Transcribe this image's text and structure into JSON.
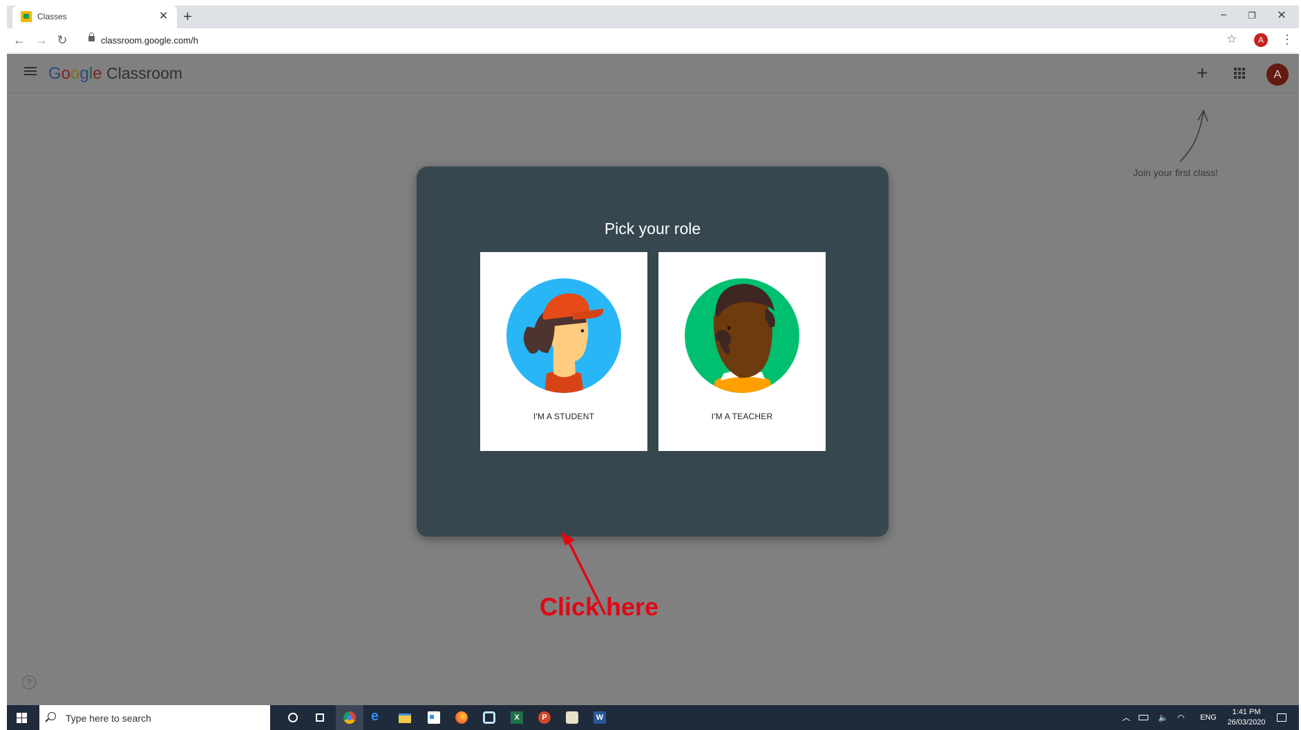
{
  "browser": {
    "tab_title": "Classes",
    "tab_close": "✕",
    "new_tab": "+",
    "url": "classroom.google.com/h",
    "profile_initial": "A",
    "window_minimize": "−",
    "window_restore": "❐",
    "window_close": "✕"
  },
  "app": {
    "logo_letters": [
      "G",
      "o",
      "o",
      "g",
      "l",
      "e"
    ],
    "product_name": "Classroom",
    "avatar_initial": "A",
    "join_hint": "Join your first class!",
    "help_glyph": "?"
  },
  "dialog": {
    "title": "Pick your role",
    "student_label": "I'M A STUDENT",
    "teacher_label": "I'M A TEACHER"
  },
  "annotation": {
    "text": "Click here",
    "color": "#e30613"
  },
  "taskbar": {
    "search_placeholder": "Type here to search",
    "language": "ENG",
    "time": "1:41 PM",
    "date": "26/03/2020"
  },
  "colors": {
    "dialog_bg": "#37474f",
    "student_circle": "#29b6f6",
    "teacher_circle": "#00c070",
    "overlay": "#808080"
  }
}
